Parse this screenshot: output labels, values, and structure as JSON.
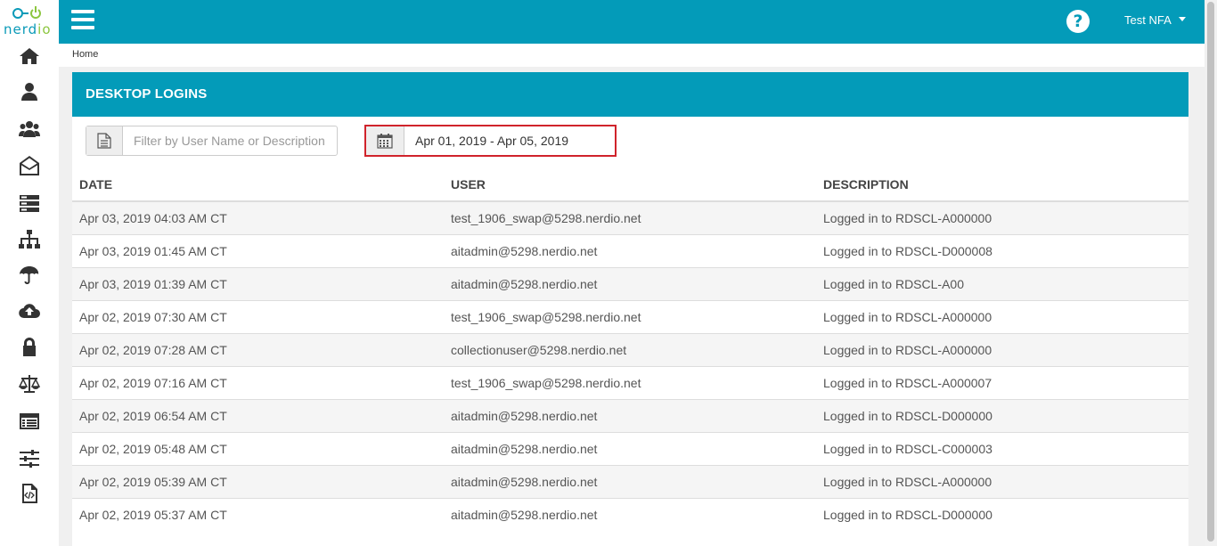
{
  "logo": {
    "text_n": "nerd",
    "text_i": "io"
  },
  "rail_icons": [
    "home-icon",
    "user-icon",
    "users-group-icon",
    "envelope-open-icon",
    "server-icon",
    "sitemap-icon",
    "umbrella-icon",
    "cloud-upload-icon",
    "lock-icon",
    "balance-scale-icon",
    "list-icon",
    "sliders-icon",
    "code-file-icon"
  ],
  "header": {
    "help_label": "?",
    "user_name": "Test NFA"
  },
  "breadcrumb": "Home",
  "panel": {
    "title": "DESKTOP LOGINS"
  },
  "filter": {
    "placeholder": "Filter by User Name or Description",
    "value": ""
  },
  "date_range": {
    "value": "Apr 01, 2019 - Apr 05, 2019"
  },
  "table": {
    "columns": [
      "DATE",
      "USER",
      "DESCRIPTION"
    ],
    "rows": [
      [
        "Apr 03, 2019 04:03 AM CT",
        "test_1906_swap@5298.nerdio.net",
        "Logged in to RDSCL-A000000"
      ],
      [
        "Apr 03, 2019 01:45 AM CT",
        "aitadmin@5298.nerdio.net",
        "Logged in to RDSCL-D000008"
      ],
      [
        "Apr 03, 2019 01:39 AM CT",
        "aitadmin@5298.nerdio.net",
        "Logged in to RDSCL-A00"
      ],
      [
        "Apr 02, 2019 07:30 AM CT",
        "test_1906_swap@5298.nerdio.net",
        "Logged in to RDSCL-A000000"
      ],
      [
        "Apr 02, 2019 07:28 AM CT",
        "collectionuser@5298.nerdio.net",
        "Logged in to RDSCL-A000000"
      ],
      [
        "Apr 02, 2019 07:16 AM CT",
        "test_1906_swap@5298.nerdio.net",
        "Logged in to RDSCL-A000007"
      ],
      [
        "Apr 02, 2019 06:54 AM CT",
        "aitadmin@5298.nerdio.net",
        "Logged in to RDSCL-D000000"
      ],
      [
        "Apr 02, 2019 05:48 AM CT",
        "aitadmin@5298.nerdio.net",
        "Logged in to RDSCL-C000003"
      ],
      [
        "Apr 02, 2019 05:39 AM CT",
        "aitadmin@5298.nerdio.net",
        "Logged in to RDSCL-A000000"
      ],
      [
        "Apr 02, 2019 05:37 AM CT",
        "aitadmin@5298.nerdio.net",
        "Logged in to RDSCL-D000000"
      ]
    ]
  },
  "colors": {
    "brand": "#039bb9",
    "highlight_border": "#d0232b",
    "logo_green": "#8cc63f"
  }
}
